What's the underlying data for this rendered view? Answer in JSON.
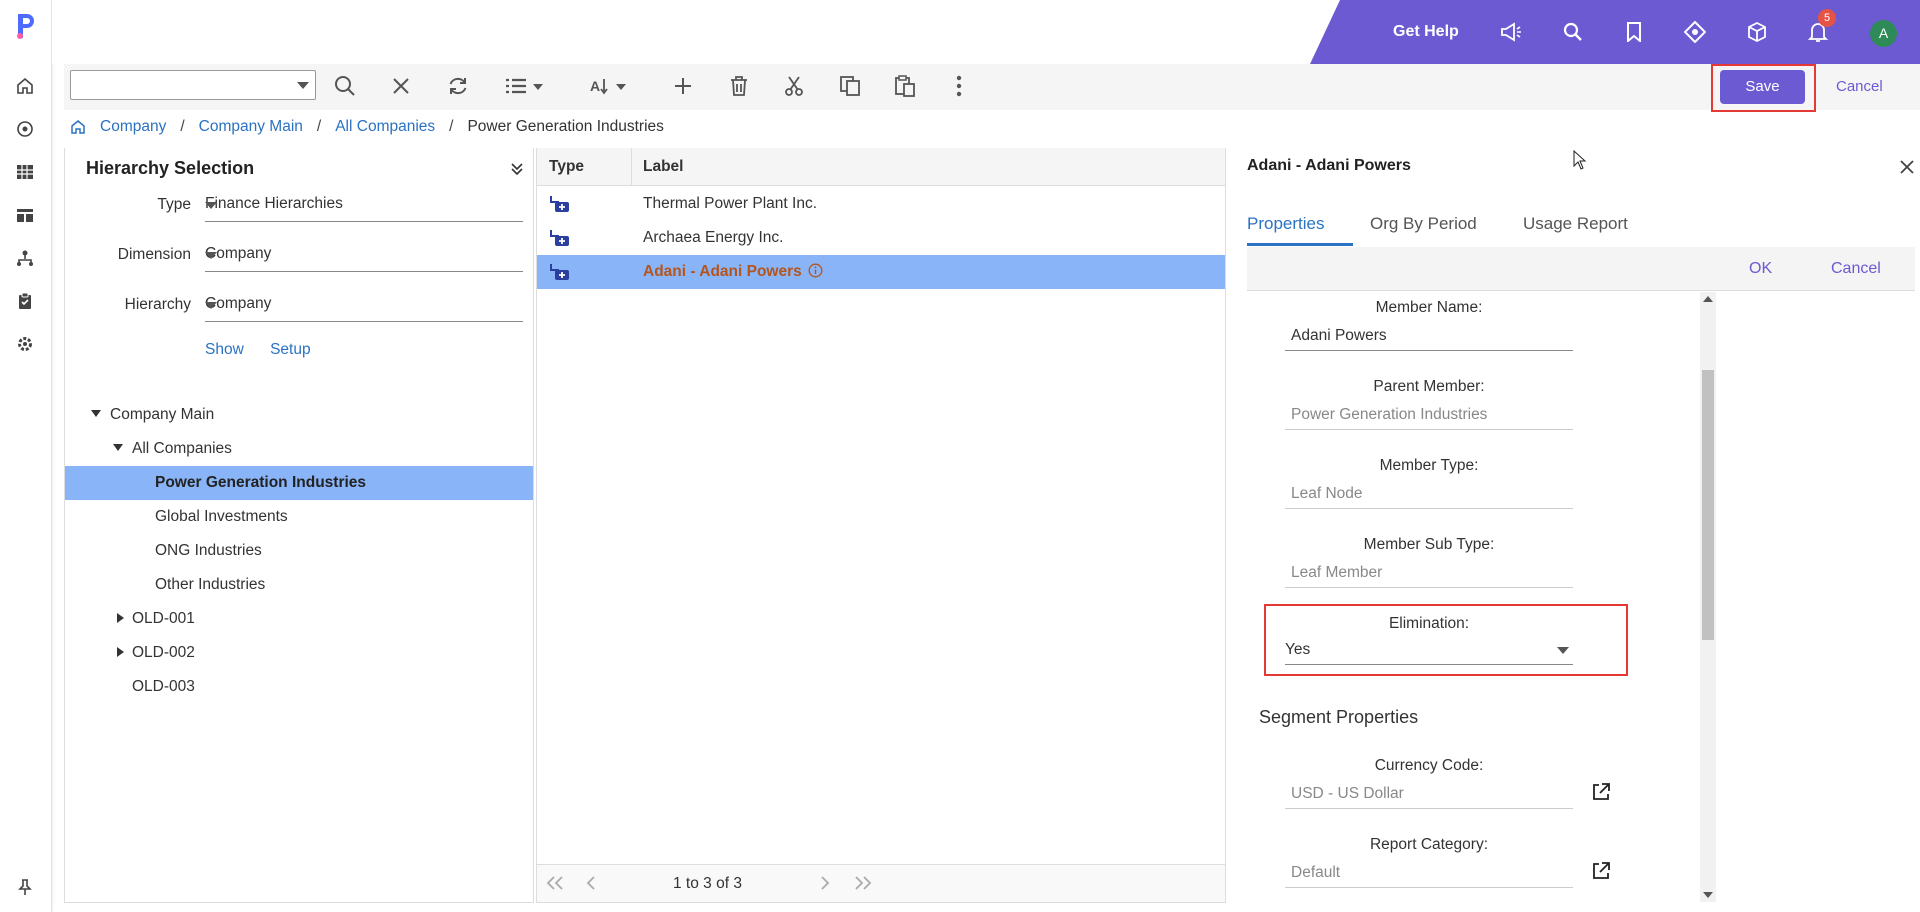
{
  "header": {
    "get_help": "Get Help",
    "notification_count": "5",
    "avatar_initial": "A"
  },
  "toolbar": {
    "save_label": "Save",
    "cancel_label": "Cancel"
  },
  "breadcrumb": {
    "items": [
      "Company",
      "Company Main",
      "All Companies"
    ],
    "current": "Power Generation Industries"
  },
  "hierarchy_selection": {
    "title": "Hierarchy Selection",
    "type_label": "Type",
    "type_value": "Finance Hierarchies",
    "dimension_label": "Dimension",
    "dimension_value": "Company",
    "hierarchy_label": "Hierarchy",
    "hierarchy_value": "Company",
    "show_link": "Show",
    "setup_link": "Setup"
  },
  "tree": [
    {
      "label": "Company Main",
      "expanded": true
    },
    {
      "label": "All Companies",
      "expanded": true
    },
    {
      "label": "Power Generation Industries",
      "selected": true
    },
    {
      "label": "Global Investments"
    },
    {
      "label": "ONG Industries"
    },
    {
      "label": "Other Industries"
    },
    {
      "label": "OLD-001",
      "expanded": false
    },
    {
      "label": "OLD-002",
      "expanded": false
    },
    {
      "label": "OLD-003"
    }
  ],
  "grid": {
    "col_type": "Type",
    "col_label": "Label",
    "rows": [
      {
        "label": "Thermal Power Plant Inc."
      },
      {
        "label": "Archaea Energy Inc."
      },
      {
        "label": "Adani - Adani Powers",
        "selected": true
      }
    ],
    "pager_text": "1 to 3 of 3"
  },
  "detail": {
    "title": "Adani - Adani Powers",
    "tabs": [
      "Properties",
      "Org By Period",
      "Usage Report"
    ],
    "ok_label": "OK",
    "cancel_label": "Cancel",
    "member_name_label": "Member Name:",
    "member_name_value": "Adani Powers",
    "parent_member_label": "Parent Member:",
    "parent_member_value": "Power Generation Industries",
    "member_type_label": "Member Type:",
    "member_type_value": "Leaf Node",
    "member_sub_type_label": "Member Sub Type:",
    "member_sub_type_value": "Leaf Member",
    "elimination_label": "Elimination:",
    "elimination_value": "Yes",
    "segment_heading": "Segment Properties",
    "currency_label": "Currency Code:",
    "currency_value": "USD - US Dollar",
    "report_category_label": "Report Category:",
    "report_category_value": "Default"
  },
  "colors": {
    "accent": "#6c5ad2",
    "link": "#2b72c2",
    "selected_row": "#8ab4f8",
    "highlight_outline": "#e53935"
  }
}
